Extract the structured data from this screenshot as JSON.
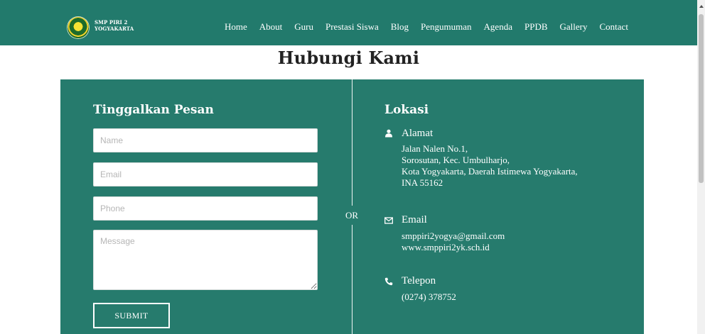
{
  "navbar": {
    "brand_line1": "SMP PIRI 2",
    "brand_line2": "YOGYAKARTA",
    "items": [
      {
        "label": "Home"
      },
      {
        "label": "About"
      },
      {
        "label": "Guru"
      },
      {
        "label": "Prestasi Siswa"
      },
      {
        "label": "Blog"
      },
      {
        "label": "Pengumuman"
      },
      {
        "label": "Agenda"
      },
      {
        "label": "PPDB"
      },
      {
        "label": "Gallery"
      },
      {
        "label": "Contact"
      }
    ]
  },
  "page_title": "Hubungi Kami",
  "form": {
    "heading": "Tinggalkan Pesan",
    "name_placeholder": "Name",
    "email_placeholder": "Email",
    "phone_placeholder": "Phone",
    "message_placeholder": "Message",
    "submit_label": "SUBMIT"
  },
  "separator": "OR",
  "location": {
    "heading": "Lokasi",
    "address": {
      "icon": "user-icon",
      "title": "Alamat",
      "lines": [
        "Jalan Nalen No.1,",
        "Sorosutan, Kec. Umbulharjo,",
        "Kota Yogyakarta, Daerah Istimewa Yogyakarta,",
        "INA 55162"
      ]
    },
    "email": {
      "icon": "envelope-icon",
      "title": "Email",
      "lines": [
        "smppiri2yogya@gmail.com",
        "www.smppiri2yk.sch.id"
      ]
    },
    "phone": {
      "icon": "phone-icon",
      "title": "Telepon",
      "lines": [
        "(0274) 378752"
      ]
    }
  },
  "colors": {
    "primary": "#227a6c",
    "panel": "#267b6d",
    "text_on_primary": "#ffffff"
  }
}
